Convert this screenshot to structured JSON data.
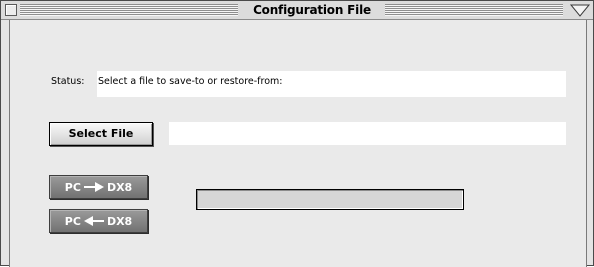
{
  "window": {
    "title": "Configuration File"
  },
  "status": {
    "label": "Status:",
    "text": "Select a file to save-to or restore-from:"
  },
  "select_file": {
    "label": "Select File",
    "path_value": ""
  },
  "transfer": {
    "pc_to_dx8": {
      "left": "PC",
      "right": "DX8",
      "arrow": "right-arrow-icon"
    },
    "dx8_to_pc": {
      "left": "PC",
      "right": "DX8",
      "arrow": "left-arrow-icon"
    }
  },
  "progress": {
    "fraction": 0
  },
  "colors": {
    "window_bg": "#e4e4e4",
    "disabled_button": "#858585",
    "field_bg": "#ffffff"
  }
}
